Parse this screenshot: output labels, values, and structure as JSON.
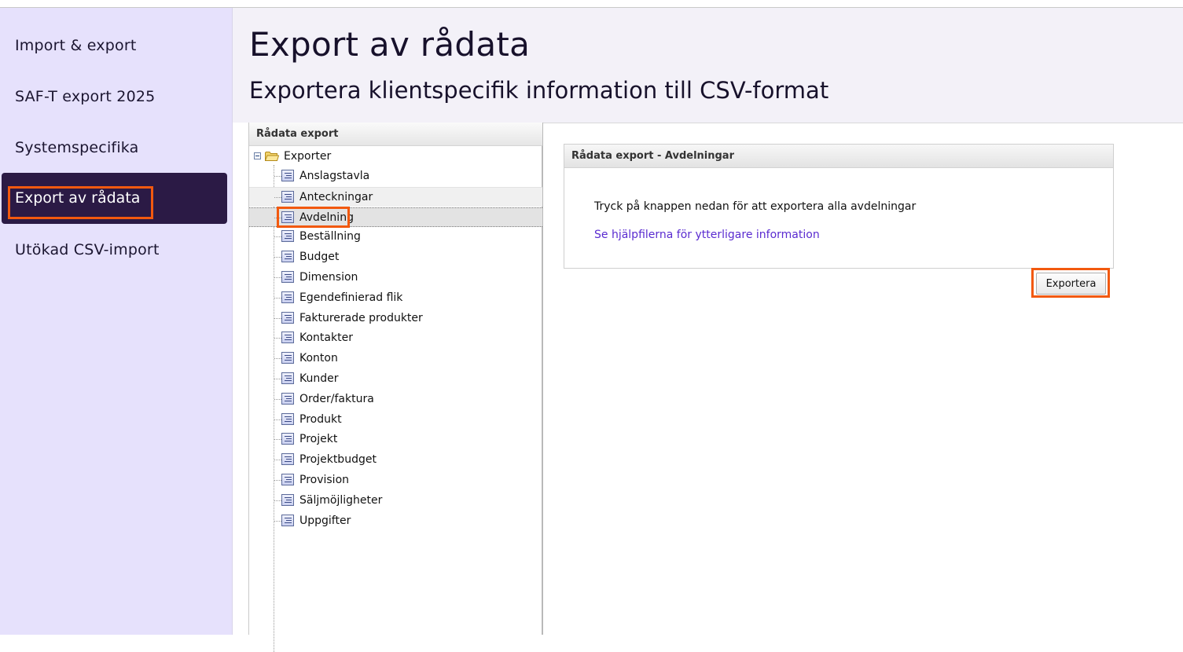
{
  "sidebar": {
    "items": [
      {
        "label": "Import & export"
      },
      {
        "label": "SAF-T export 2025"
      },
      {
        "label": "Systemspecifika"
      },
      {
        "label": "Export av rådata"
      },
      {
        "label": "Utökad CSV-import"
      }
    ],
    "active_index": 3
  },
  "header": {
    "title": "Export av rådata",
    "subtitle": "Exportera klientspecifik information till CSV-format"
  },
  "tree": {
    "panel_title": "Rådata export",
    "root_label": "Exporter",
    "root_icon": "folder-open-icon",
    "item_icon": "document-list-icon",
    "items": [
      {
        "label": "Anslagstavla"
      },
      {
        "label": "Anteckningar"
      },
      {
        "label": "Avdelning"
      },
      {
        "label": "Beställning"
      },
      {
        "label": "Budget"
      },
      {
        "label": "Dimension"
      },
      {
        "label": "Egendefinierad flik"
      },
      {
        "label": "Fakturerade produkter"
      },
      {
        "label": "Kontakter"
      },
      {
        "label": "Konton"
      },
      {
        "label": "Kunder"
      },
      {
        "label": "Order/faktura"
      },
      {
        "label": "Produkt"
      },
      {
        "label": "Projekt"
      },
      {
        "label": "Projektbudget"
      },
      {
        "label": "Provision"
      },
      {
        "label": "Säljmöjligheter"
      },
      {
        "label": "Uppgifter"
      }
    ],
    "hovered_item": "Anteckningar",
    "selected_item": "Avdelning"
  },
  "content": {
    "card_title": "Rådata export - Avdelningar",
    "instruction": "Tryck på knappen nedan för att exportera alla avdelningar",
    "help_link": "Se hjälpfilerna för ytterligare information",
    "export_button": "Exportera"
  },
  "colors": {
    "highlight": "#f2590f",
    "sidebar_bg": "#e6e1fc",
    "sidebar_active_bg": "#2b1a45",
    "link": "#5a2bd0"
  }
}
